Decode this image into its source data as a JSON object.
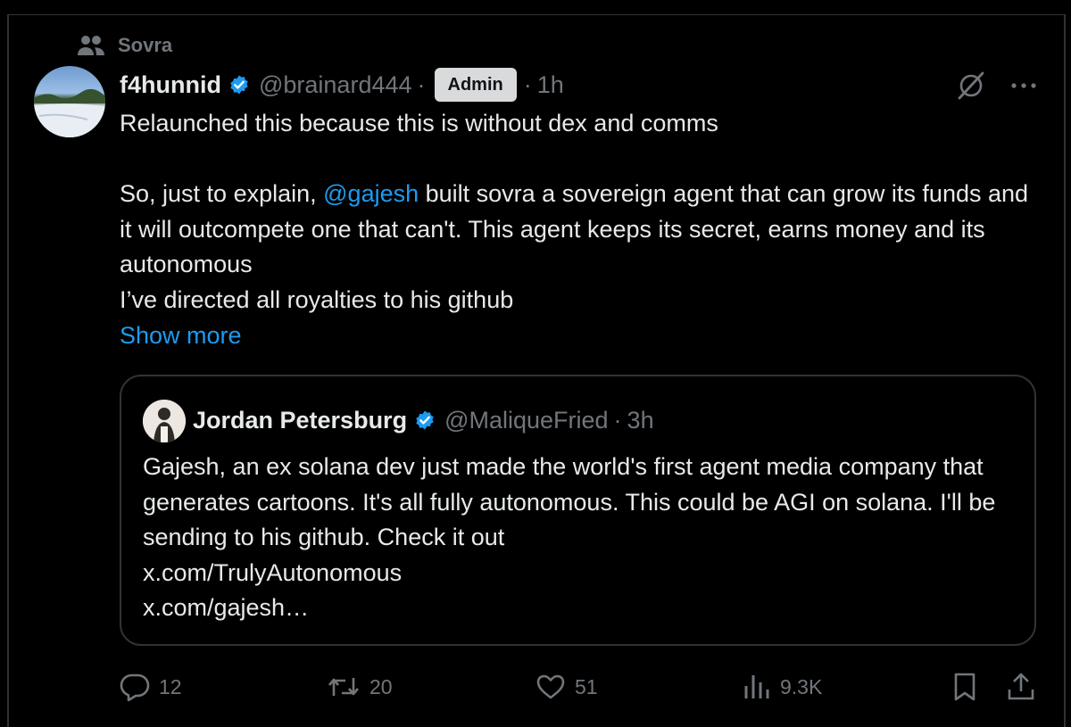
{
  "community": {
    "name": "Sovra",
    "icon": "people-icon"
  },
  "post": {
    "author_name": "f4hunnid",
    "handle": "@brainard444",
    "separator": "·",
    "role_badge": "Admin",
    "time": "1h",
    "text_before_mention": "Relaunched this because this is without dex and comms\n\nSo, just to explain, ",
    "mention": "@gajesh",
    "text_after_mention": " built sovra a sovereign agent that can grow its funds and it will outcompete one that can't. This agent keeps its secret, earns money and its autonomous\nI’ve directed all royalties to his github",
    "show_more": "Show more"
  },
  "quote": {
    "author_name": "Jordan Petersburg",
    "handle": "@MaliqueFried",
    "separator": "·",
    "time": "3h",
    "text": "Gajesh, an ex solana dev just made the world's first agent media company that generates cartoons. It's all fully autonomous. This could be AGI on solana. I'll be sending to his github. Check it out\nx.com/TrulyAutonomous\nx.com/gajesh…"
  },
  "actions": {
    "replies": "12",
    "reposts": "20",
    "likes": "51",
    "views": "9.3K"
  },
  "colors": {
    "accent": "#1d9bf0",
    "muted": "#71767b",
    "text": "#e7e9ea",
    "border": "#2f3336",
    "background": "#000000"
  }
}
